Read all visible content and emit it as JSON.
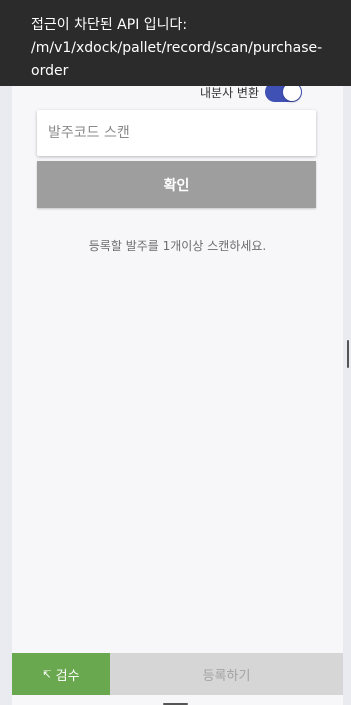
{
  "toast": {
    "line1": "접근이 차단된 API 입니다:",
    "line2": "/m/v1/xdock/pallet/record/scan/purchase-",
    "line3": "order"
  },
  "toggle": {
    "label": "내분사 변환",
    "on": true,
    "color": "#3f51b5"
  },
  "scan": {
    "placeholder": "발주코드 스캔",
    "value": ""
  },
  "confirm": {
    "label": "확인"
  },
  "hint": "등록할 발주를 1개이상 스캔하세요.",
  "bottom": {
    "inspect_icon": "↸",
    "inspect_label": "검수",
    "register_label": "등록하기",
    "accent_color": "#6aa84f"
  }
}
